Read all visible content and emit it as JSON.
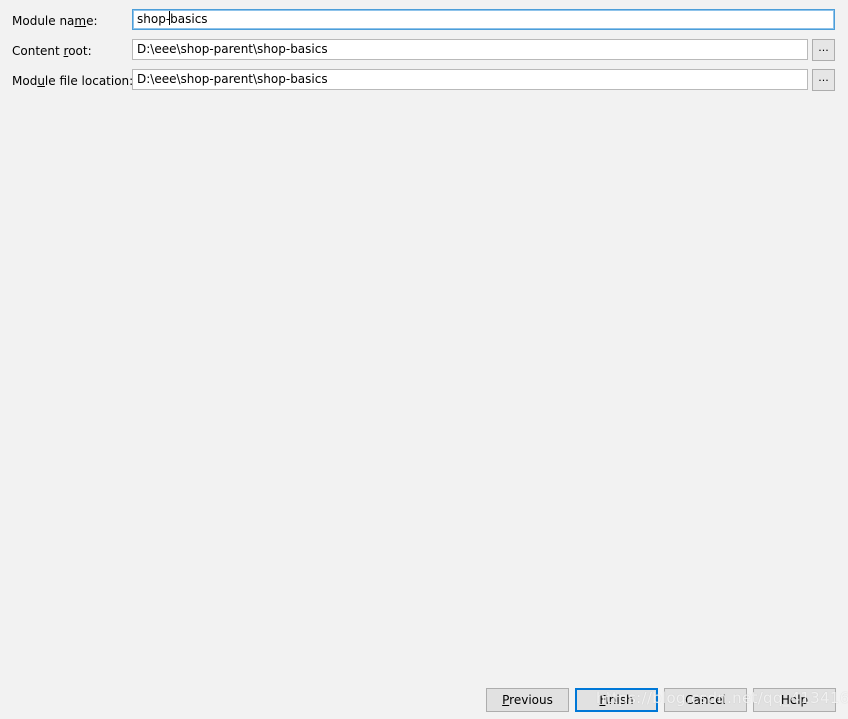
{
  "module_name": {
    "label_pre": "Module na",
    "label_mn": "m",
    "label_post": "e:",
    "value_before_caret": "shop-",
    "value_after_caret": "basics"
  },
  "content_root": {
    "label_pre": "Content ",
    "label_mn": "r",
    "label_post": "oot:",
    "value": "D:\\eee\\shop-parent\\shop-basics",
    "browse_label": "..."
  },
  "module_file_location": {
    "label_pre": "Mod",
    "label_mn": "u",
    "label_post": "le file location:",
    "value": "D:\\eee\\shop-parent\\shop-basics",
    "browse_label": "..."
  },
  "buttons": {
    "previous": {
      "mn": "P",
      "rest": "revious"
    },
    "finish": {
      "mn": "F",
      "rest": "inish"
    },
    "cancel": {
      "label": "Cancel"
    },
    "help": {
      "label": "Help"
    }
  },
  "watermark": "https://blog.csdn.net/qq_41341612",
  "colors": {
    "background": "#f2f2f2",
    "focus_border": "#4c9ed9",
    "default_button_border": "#0078d7"
  }
}
